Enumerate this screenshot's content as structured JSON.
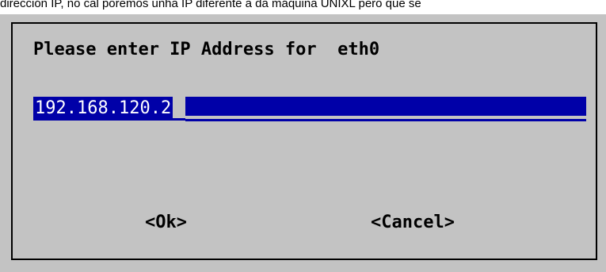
{
  "caption": "dirección IP, no cal poremos unha IP diferente a da máquina UNIXL pero que se",
  "dialog": {
    "prompt": "Please enter IP Address for  eth0",
    "ip_value": "192.168.120.2",
    "ok_label": "<Ok>",
    "cancel_label": "<Cancel>"
  },
  "colors": {
    "screen_background": "#c3c3c3",
    "field_background": "#0000a8",
    "field_text": "#ffffff",
    "border": "#000000"
  }
}
